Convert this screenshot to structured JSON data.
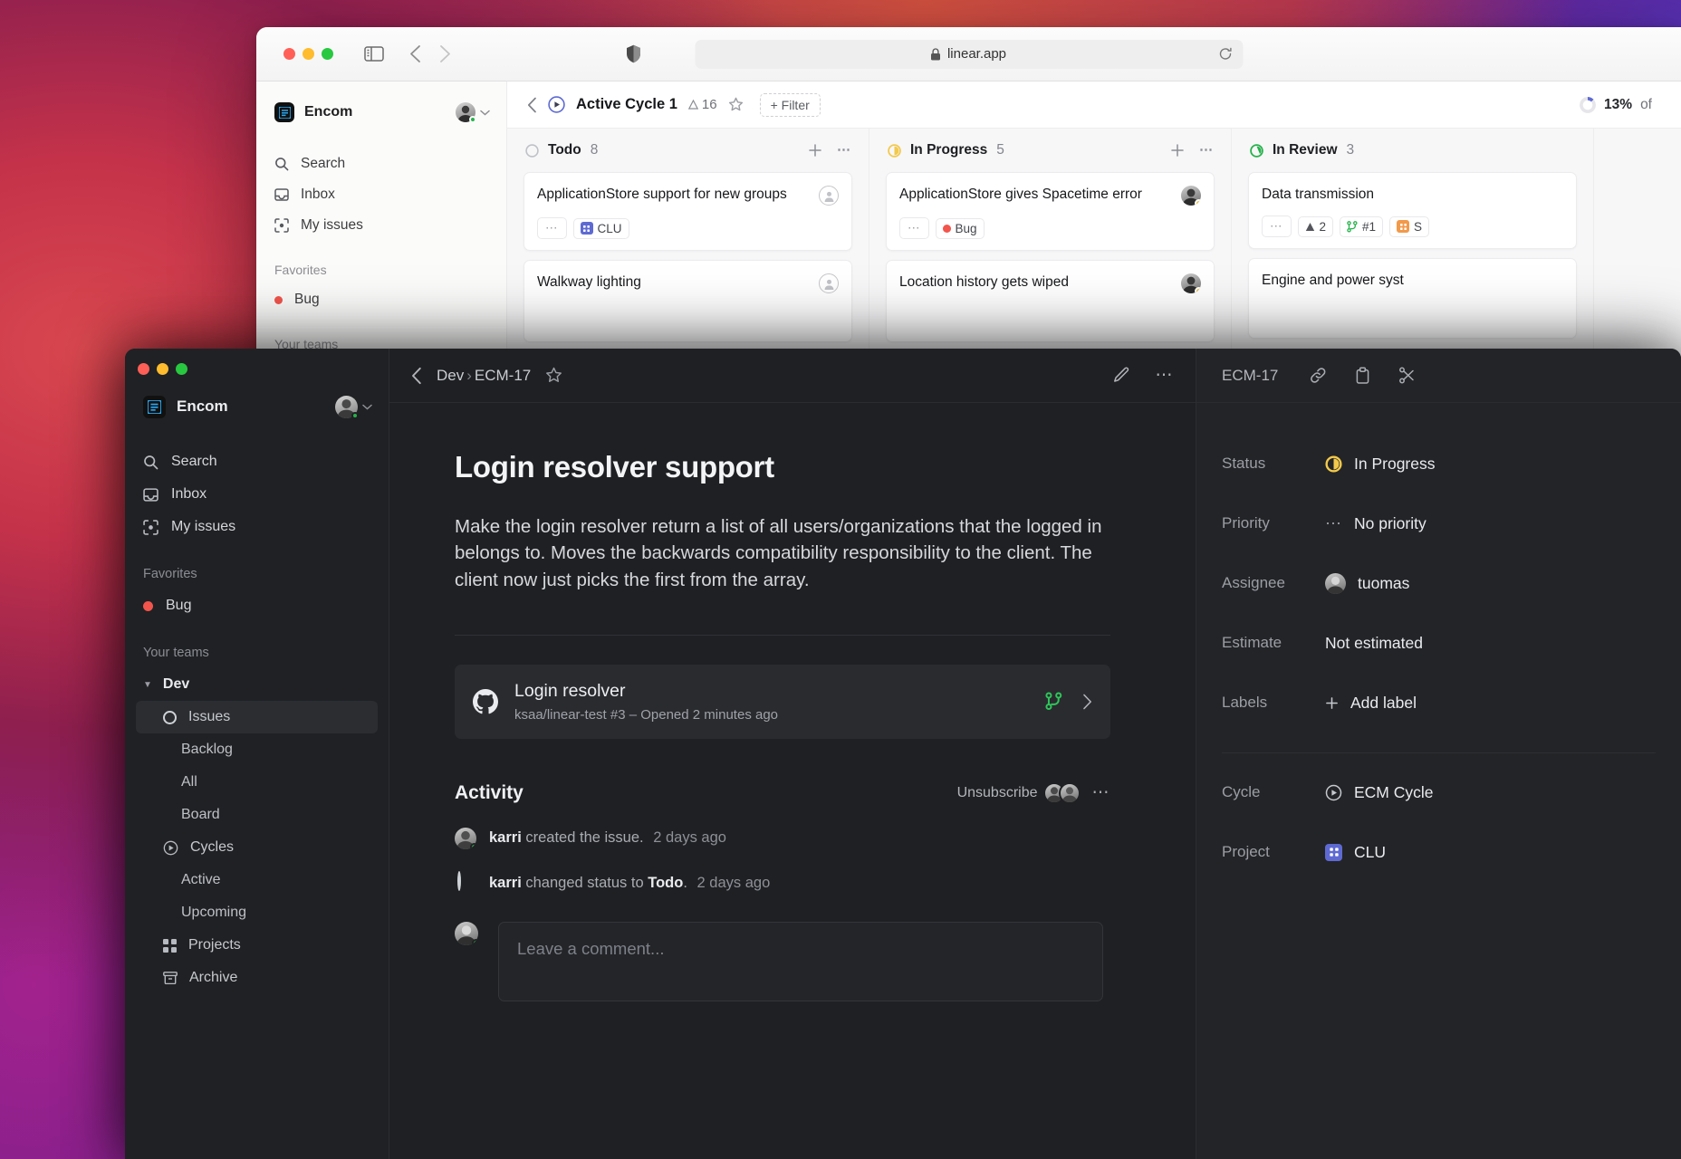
{
  "browser": {
    "url": "linear.app",
    "lock_icon": "lock-icon",
    "reload_icon": "reload-icon",
    "sidebar_toggle_icon": "sidebar-toggle-icon",
    "back_icon": "back-arrow-icon",
    "forward_icon": "forward-arrow-icon",
    "shield_icon": "privacy-shield-icon"
  },
  "back_window": {
    "sidebar": {
      "org_name": "Encom",
      "nav": [
        {
          "label": "Search",
          "icon": "search-icon"
        },
        {
          "label": "Inbox",
          "icon": "inbox-icon"
        },
        {
          "label": "My issues",
          "icon": "my-issues-icon"
        }
      ],
      "favorites_label": "Favorites",
      "favorites": [
        {
          "label": "Bug",
          "color": "#f2554c"
        }
      ],
      "teams_label": "Your teams"
    },
    "header": {
      "title": "Active Cycle 1",
      "count": "16",
      "filter_label": "+ Filter",
      "progress_pct": "13%",
      "progress_suffix": "of",
      "star_icon": "star-icon",
      "cycle_icon": "cycle-play-icon",
      "back_icon": "back-arrow-icon"
    },
    "columns": [
      {
        "name": "Todo",
        "count": "8",
        "status_color": "#bfc1c6",
        "cards": [
          {
            "title": "ApplicationStore support for new groups",
            "assignee": "unassigned",
            "chips": [
              {
                "type": "more",
                "label": "⋯"
              },
              {
                "type": "project",
                "label": "CLU",
                "color": "#5e6ad2"
              }
            ]
          },
          {
            "title": "Walkway lighting",
            "assignee": "unassigned",
            "chips": []
          }
        ]
      },
      {
        "name": "In Progress",
        "count": "5",
        "status_color": "#f2c94c",
        "cards": [
          {
            "title": "ApplicationStore gives Spacetime error",
            "assignee": "photo",
            "badge_color": "#f2c94c",
            "chips": [
              {
                "type": "more",
                "label": "⋯"
              },
              {
                "type": "label",
                "label": "Bug",
                "color": "#f2554c"
              }
            ]
          },
          {
            "title": "Location history gets wiped",
            "assignee": "photo",
            "badge_color": "#f2c94c",
            "chips": []
          }
        ]
      },
      {
        "name": "In Review",
        "count": "3",
        "status_color": "#26b24b",
        "cards": [
          {
            "title": "Data transmission",
            "chips": [
              {
                "type": "more",
                "label": "⋯"
              },
              {
                "type": "warn",
                "label": "2"
              },
              {
                "type": "branch",
                "label": "#1"
              },
              {
                "type": "project",
                "label": "S",
                "color": "#f2994a"
              }
            ]
          },
          {
            "title": "Engine and power syst",
            "chips": []
          }
        ]
      }
    ]
  },
  "front_window": {
    "sidebar": {
      "org_name": "Encom",
      "nav": [
        {
          "label": "Search",
          "icon": "search-icon"
        },
        {
          "label": "Inbox",
          "icon": "inbox-icon"
        },
        {
          "label": "My issues",
          "icon": "my-issues-icon"
        }
      ],
      "favorites_label": "Favorites",
      "favorites": [
        {
          "label": "Bug",
          "color": "#f2554c"
        }
      ],
      "teams_label": "Your teams",
      "team_name": "Dev",
      "team_items": [
        {
          "label": "Issues",
          "selected": true,
          "icon": "circle-icon"
        },
        {
          "label": "Backlog",
          "selected": false,
          "icon": ""
        },
        {
          "label": "All",
          "selected": false,
          "icon": ""
        },
        {
          "label": "Board",
          "selected": false,
          "icon": ""
        },
        {
          "label": "Cycles",
          "selected": false,
          "icon": "cycle-play-icon"
        },
        {
          "label": "Active",
          "selected": false,
          "icon": ""
        },
        {
          "label": "Upcoming",
          "selected": false,
          "icon": ""
        },
        {
          "label": "Projects",
          "selected": false,
          "icon": "projects-grid-icon"
        },
        {
          "label": "Archive",
          "selected": false,
          "icon": "archive-icon"
        }
      ]
    },
    "topbar": {
      "breadcrumb_team": "Dev",
      "breadcrumb_sep": "›",
      "breadcrumb_id": "ECM-17",
      "star_icon": "star-icon",
      "back_icon": "back-arrow-icon",
      "edit_icon": "pencil-edit-icon",
      "more_icon": "more-options-icon"
    },
    "issue": {
      "title": "Login resolver support",
      "description": "Make the login resolver return a list of all users/organizations that the logged in belongs to. Moves the backwards compatibility responsibility to the client. The client now just picks the first from the array."
    },
    "github_link": {
      "icon": "github-icon",
      "title": "Login resolver",
      "subtitle": "ksaa/linear-test #3 – Opened 2 minutes ago",
      "branch_icon": "git-branch-icon",
      "chevron_icon": "chevron-right-icon"
    },
    "activity": {
      "title": "Activity",
      "unsubscribe_label": "Unsubscribe",
      "more_icon": "more-options-icon",
      "entries": [
        {
          "who": "karri",
          "what": "created the issue.",
          "when": "2 days ago",
          "icon": "avatar"
        },
        {
          "who": "karri",
          "what": "changed status to",
          "target": "Todo",
          "suffix": ".",
          "when": "2 days ago",
          "icon": "circle-icon"
        }
      ],
      "comment_placeholder": "Leave a comment..."
    },
    "properties": {
      "issue_id": "ECM-17",
      "link_icon": "link-copy-icon",
      "copy_icon": "clipboard-copy-icon",
      "split_icon": "split-icon",
      "rows": [
        {
          "label": "Status",
          "value": "In Progress",
          "icon": "in-progress-icon",
          "color": "#f2c94c"
        },
        {
          "label": "Priority",
          "value": "No priority",
          "icon": "priority-none-icon"
        },
        {
          "label": "Assignee",
          "value": "tuomas",
          "icon": "avatar"
        },
        {
          "label": "Estimate",
          "value": "Not estimated",
          "icon": ""
        },
        {
          "label": "Labels",
          "value": "Add label",
          "icon": "plus-icon"
        }
      ],
      "rows2": [
        {
          "label": "Cycle",
          "value": "ECM Cycle",
          "icon": "cycle-play-icon"
        },
        {
          "label": "Project",
          "value": "CLU",
          "icon": "project-icon",
          "color": "#5e6ad2"
        }
      ]
    }
  }
}
